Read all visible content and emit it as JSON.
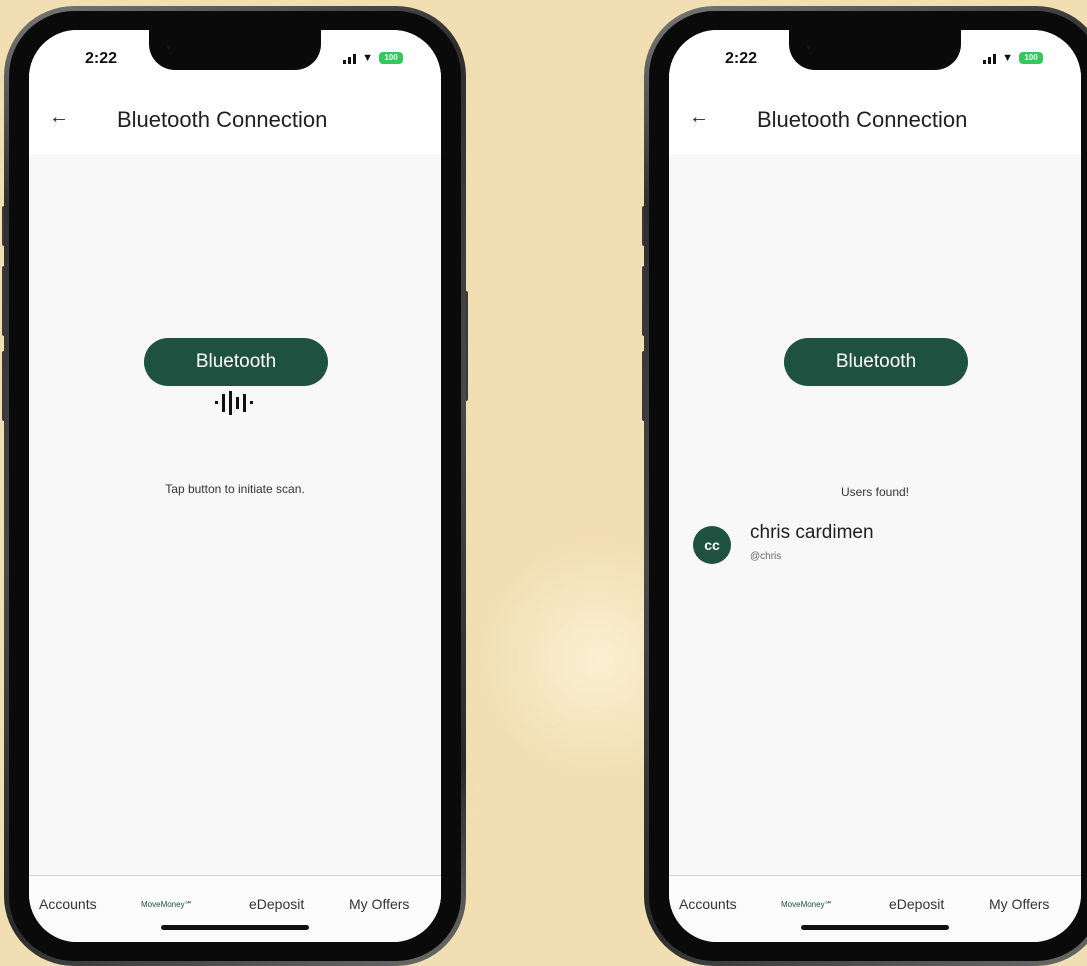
{
  "screens": [
    {
      "status_time": "2:22",
      "battery": "100",
      "title": "Bluetooth Connection",
      "bluetooth_label": "Bluetooth",
      "hint": "Tap button to initiate scan."
    },
    {
      "status_time": "2:22",
      "battery": "100",
      "title": "Bluetooth Connection",
      "bluetooth_label": "Bluetooth",
      "found_label": "Users found!",
      "user": {
        "initials": "cc",
        "name": "chris cardimen",
        "handle": "@chris"
      }
    }
  ],
  "tabs": {
    "accounts": "Accounts",
    "move_money": "MoveMoney℠",
    "edeposit": "eDeposit",
    "my_offers": "My Offers"
  },
  "colors": {
    "accent": "#1e5140",
    "background": "#f1dfb3",
    "battery": "#34c759"
  },
  "icons": [
    "back-arrow-icon",
    "signal-icon",
    "wifi-icon",
    "battery-icon",
    "sound-wave-icon"
  ]
}
